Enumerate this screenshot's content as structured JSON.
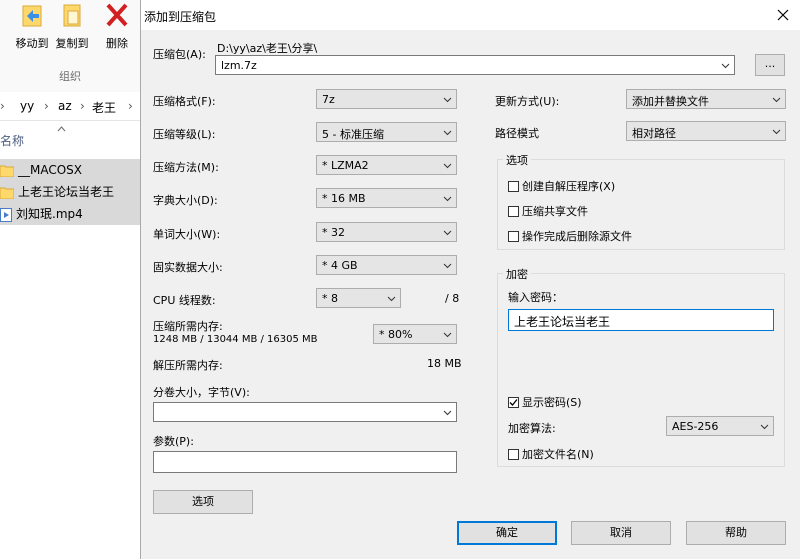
{
  "explorer": {
    "ribbon": {
      "move_to": "移动到",
      "copy_to": "复制到",
      "delete": "删除",
      "group": "组织",
      "top_partial_1": "",
      "top_partial_2": ""
    },
    "breadcrumb": [
      "yy",
      "az",
      "老王"
    ],
    "column_name": "名称",
    "files": [
      {
        "name": "__MACOSX",
        "type": "folder"
      },
      {
        "name": "上老王论坛当老王",
        "type": "folder"
      },
      {
        "name": "刘知珉.mp4",
        "type": "video"
      }
    ]
  },
  "dialog": {
    "title": "添加到压缩包",
    "archive_label": "压缩包(A):",
    "archive_path": "D:\\yy\\az\\老王\\分享\\",
    "archive_name": "lzm.7z",
    "browse_label": "...",
    "left": {
      "format_label": "压缩格式(F):",
      "format_value": "7z",
      "level_label": "压缩等级(L):",
      "level_value": "5 - 标准压缩",
      "method_label": "压缩方法(M):",
      "method_value": "* LZMA2",
      "dict_label": "字典大小(D):",
      "dict_value": "* 16 MB",
      "word_label": "单词大小(W):",
      "word_value": "* 32",
      "solid_label": "固实数据大小:",
      "solid_value": "* 4 GB",
      "threads_label": "CPU 线程数:",
      "threads_value": "* 8",
      "threads_max": "/ 8",
      "mem_comp_label": "压缩所需内存:",
      "mem_comp_detail": "1248 MB / 13044 MB / 16305 MB",
      "mem_comp_value": "* 80%",
      "mem_decomp_label": "解压所需内存:",
      "mem_decomp_value": "18 MB",
      "volume_label": "分卷大小，字节(V):",
      "volume_value": "",
      "params_label": "参数(P):",
      "params_value": "",
      "options_button": "选项"
    },
    "right": {
      "update_label": "更新方式(U):",
      "update_value": "添加并替换文件",
      "path_label": "路径模式",
      "path_value": "相对路径",
      "options_group": "选项",
      "opt_sfx": "创建自解压程序(X)",
      "opt_shared": "压缩共享文件",
      "opt_delete": "操作完成后删除源文件",
      "encryption_group": "加密",
      "password_label": "输入密码：",
      "password_value": "上老王论坛当老王",
      "show_password": "显示密码(S)",
      "method_label": "加密算法:",
      "method_value": "AES-256",
      "encrypt_names": "加密文件名(N)"
    },
    "checks": {
      "sfx": false,
      "shared": false,
      "delete": false,
      "show_password": true,
      "encrypt_names": false
    },
    "buttons": {
      "ok": "确定",
      "cancel": "取消",
      "help": "帮助"
    }
  },
  "colors": {
    "accent": "#0078d7",
    "dialog_bg": "#f0f0f0",
    "selection": "#d9d9d9"
  }
}
